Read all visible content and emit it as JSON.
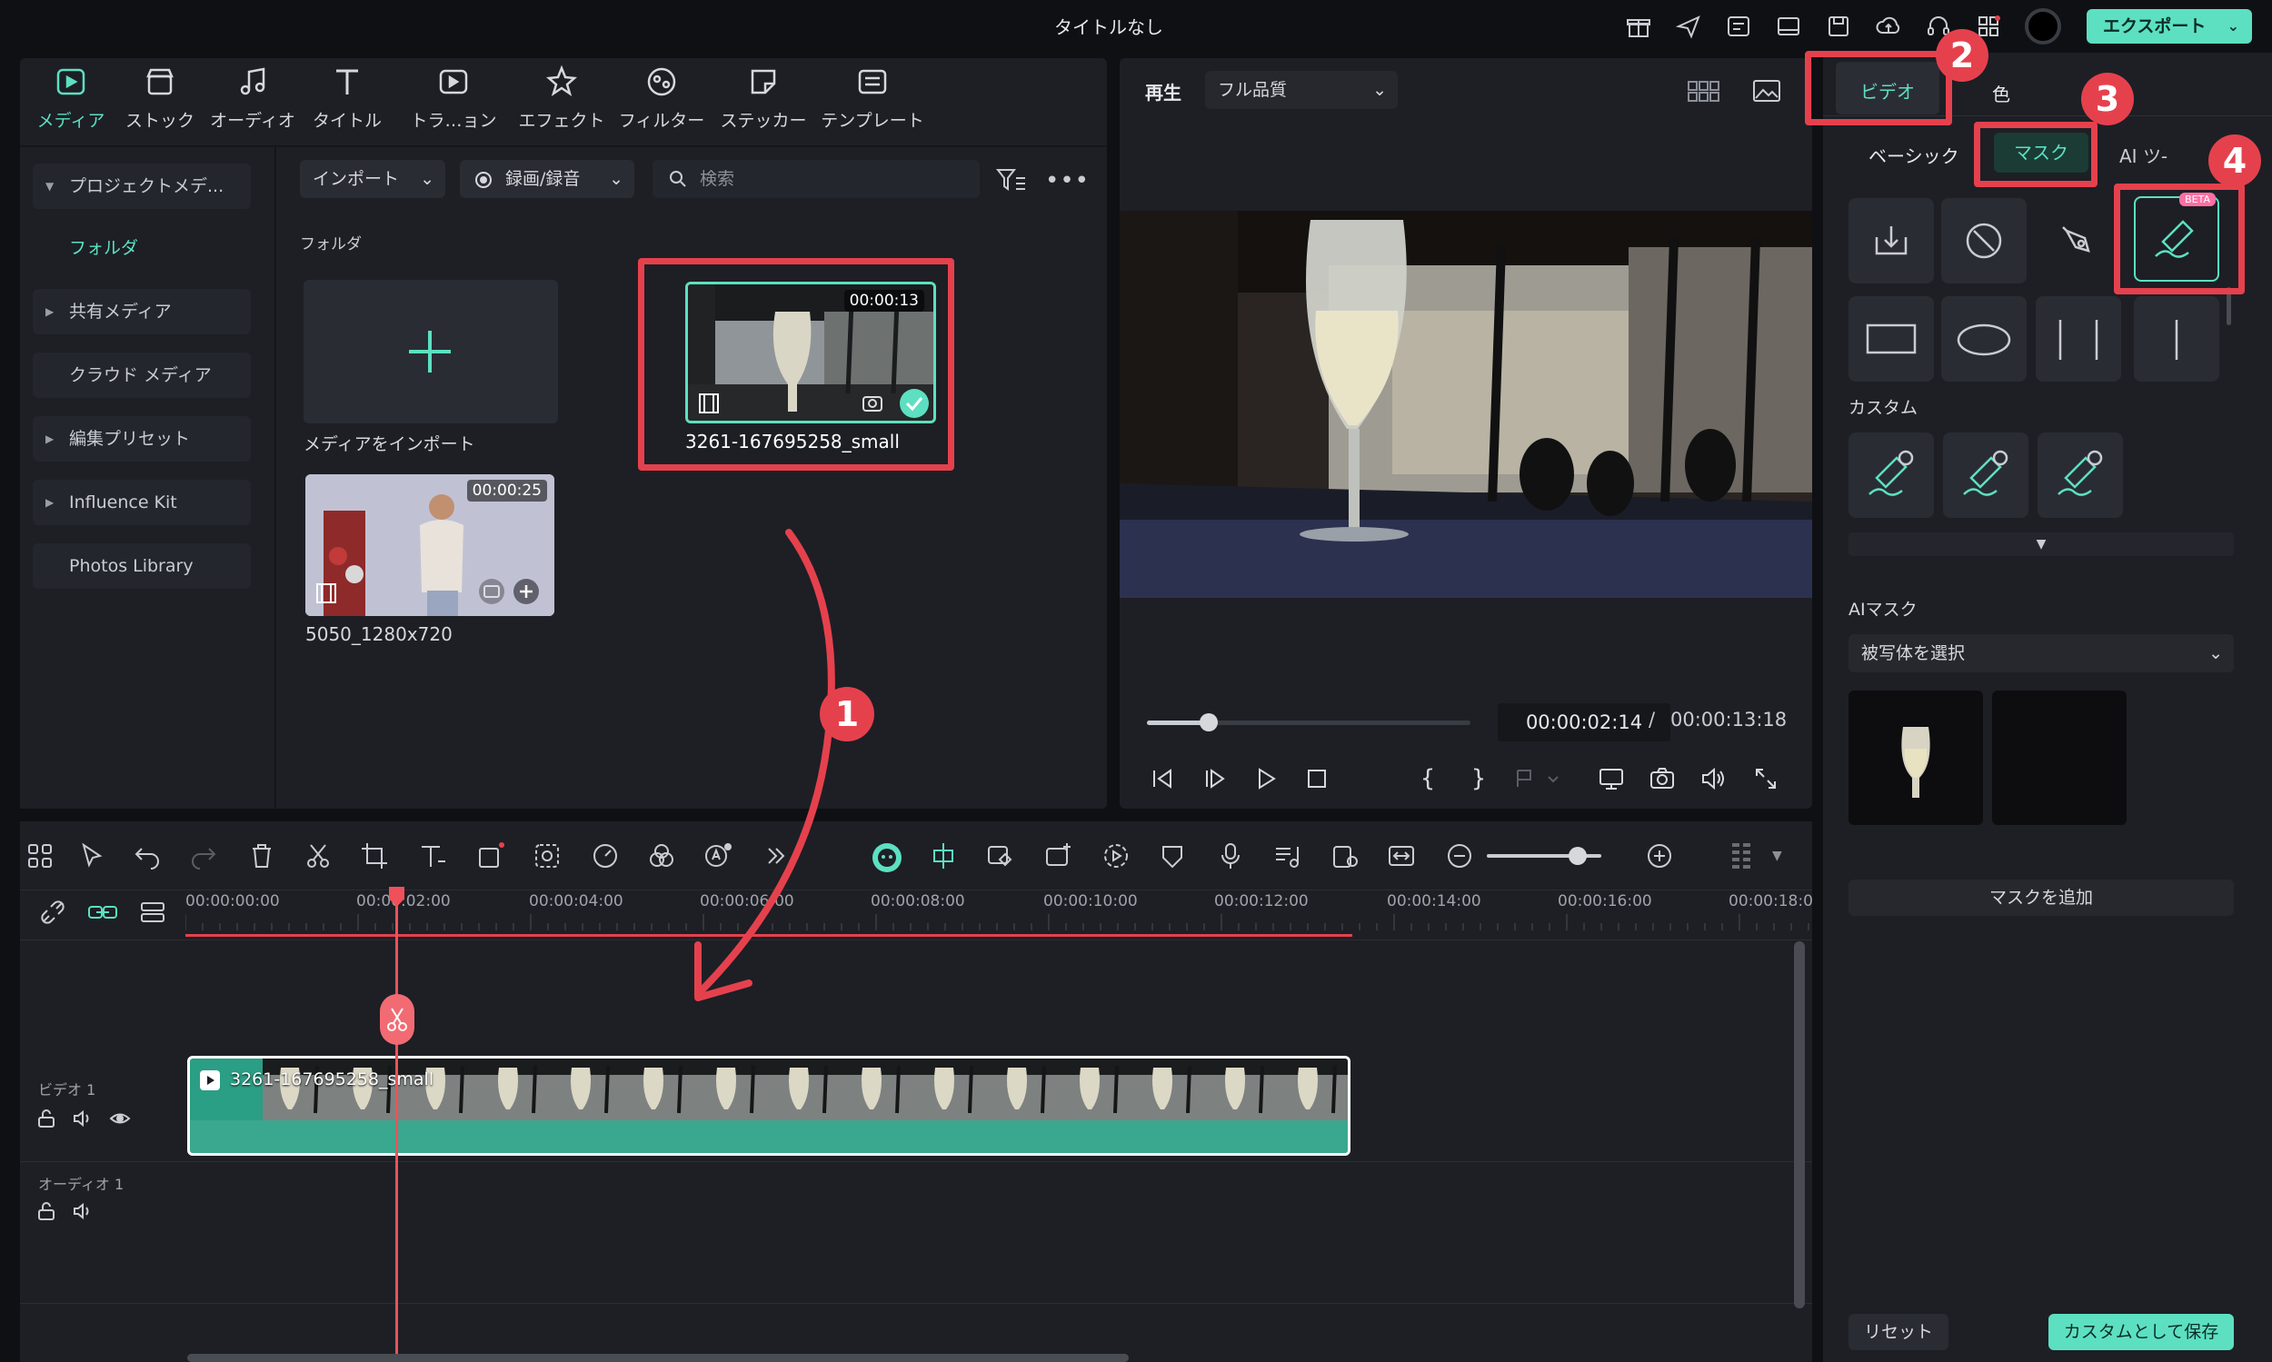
{
  "window": {
    "title": "タイトルなし",
    "export_label": "エクスポート"
  },
  "toolbar": {
    "tabs": [
      {
        "label": "メディア",
        "active": true
      },
      {
        "label": "ストック"
      },
      {
        "label": "オーディオ"
      },
      {
        "label": "タイトル"
      },
      {
        "label": "トラ…ョン"
      },
      {
        "label": "エフェクト"
      },
      {
        "label": "フィルター"
      },
      {
        "label": "ステッカー"
      },
      {
        "label": "テンプレート"
      }
    ]
  },
  "sidebar": {
    "items": [
      {
        "label": "プロジェクトメデ..."
      },
      {
        "label": "フォルダ"
      },
      {
        "label": "共有メディア"
      },
      {
        "label": "クラウド メディア"
      },
      {
        "label": "編集プリセット"
      },
      {
        "label": "Influence Kit"
      },
      {
        "label": "Photos Library"
      }
    ]
  },
  "media": {
    "import_label": "インポート",
    "record_label": "録画/録音",
    "search_placeholder": "検索",
    "folder_label": "フォルダ",
    "import_tile_label": "メディアをインポート",
    "clips": [
      {
        "name": "3261-167695258_small",
        "duration": "00:00:13"
      },
      {
        "name": "5050_1280x720",
        "duration": "00:00:25"
      }
    ]
  },
  "player": {
    "play_label": "再生",
    "quality": "フル品質",
    "current_time": "00:00:02:14",
    "separator": "/",
    "total_time": "00:00:13:18",
    "progress": 0.19
  },
  "inspector": {
    "tabs": [
      {
        "label": "ビデオ",
        "active": true
      },
      {
        "label": "色"
      }
    ],
    "subtabs": [
      {
        "label": "ベーシック"
      },
      {
        "label": "マスク",
        "active": true
      },
      {
        "label": "AI ツ-"
      }
    ],
    "custom_label": "カスタム",
    "ai_mask_label": "AIマスク",
    "ai_mask_select": "被写体を選択",
    "add_mask_label": "マスクを追加",
    "reset_label": "リセット",
    "save_custom_label": "カスタムとして保存",
    "beta_label": "BETA"
  },
  "timeline": {
    "ruler": [
      "00:00:00:00",
      "00:00:02:00",
      "00:00:04:00",
      "00:00:06:00",
      "00:00:08:00",
      "00:00:10:00",
      "00:00:12:00",
      "00:00:14:00",
      "00:00:16:00",
      "00:00:18:0"
    ],
    "video_track_label": "ビデオ 1",
    "audio_track_label": "オーディオ 1",
    "clip_name": "3261-167695258_small"
  },
  "annotations": {
    "step1": "1",
    "step2": "2",
    "step3": "3",
    "step4": "4"
  },
  "colors": {
    "accent": "#5ce0c1",
    "annotation_red": "#e5414d",
    "playhead": "#f0505a"
  }
}
